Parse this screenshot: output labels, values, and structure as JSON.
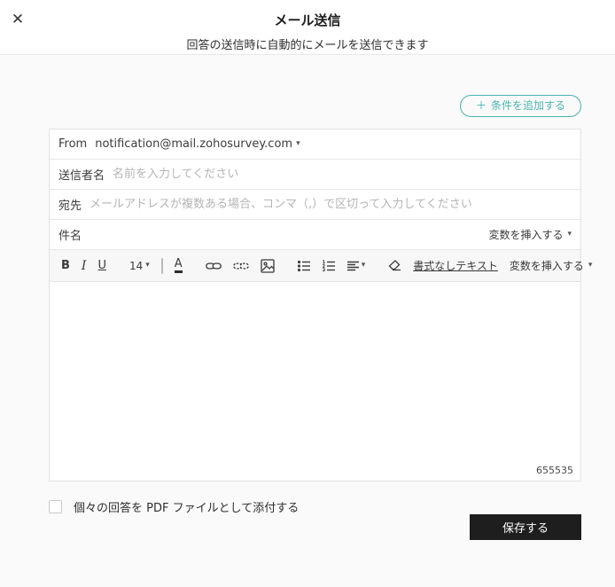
{
  "header": {
    "title": "メール送信",
    "subtitle": "回答の送信時に自動的にメールを送信できます"
  },
  "icons": {
    "close": "✕",
    "plus": "＋",
    "caret_down": "▾"
  },
  "colors": {
    "accent_teal": "#46b4ae",
    "save_button_bg": "#1e1e1e",
    "page_bg": "#fafafa",
    "border": "#e2e2e2",
    "placeholder": "#b5b5b5"
  },
  "actions": {
    "add_condition_label": "条件を追加する",
    "save_label": "保存する"
  },
  "form": {
    "from": {
      "label": "From",
      "value": "notification@mail.zohosurvey.com"
    },
    "sender": {
      "label": "送信者名",
      "placeholder": "名前を入力してください",
      "value": ""
    },
    "to": {
      "label": "宛先",
      "placeholder": "メールアドレスが複数ある場合、コンマ（,）で区切って入力してください",
      "value": ""
    },
    "subject": {
      "label": "件名",
      "value": "",
      "insert_variable_label": "変数を挿入する"
    },
    "attach_pdf": {
      "label": "個々の回答を PDF ファイルとして添付する",
      "checked": false
    }
  },
  "editor": {
    "toolbar": {
      "bold_label": "B",
      "italic_label": "I",
      "underline_label": "U",
      "font_size": "14",
      "font_color_label": "A",
      "plain_text_label": "書式なしテキスト",
      "insert_variable_label": "変数を挿入する"
    },
    "body_text": "",
    "char_counter": "655535"
  }
}
